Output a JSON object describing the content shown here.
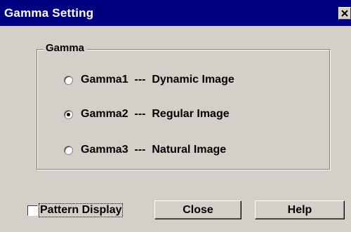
{
  "window": {
    "title": "Gamma Setting",
    "close_icon": "close-x-icon"
  },
  "gamma_group": {
    "label": "Gamma",
    "options": [
      {
        "name": "Gamma1",
        "separator": "---",
        "description": "Dynamic Image",
        "selected": false
      },
      {
        "name": "Gamma2",
        "separator": "---",
        "description": "Regular Image",
        "selected": true
      },
      {
        "name": "Gamma3",
        "separator": "---",
        "description": "Natural Image",
        "selected": false
      }
    ]
  },
  "pattern_display": {
    "label": "Pattern Display",
    "checked": false
  },
  "buttons": {
    "close_label": "Close",
    "help_label": "Help"
  },
  "colors": {
    "titlebar": "#000080",
    "face": "#d4d0c8"
  }
}
